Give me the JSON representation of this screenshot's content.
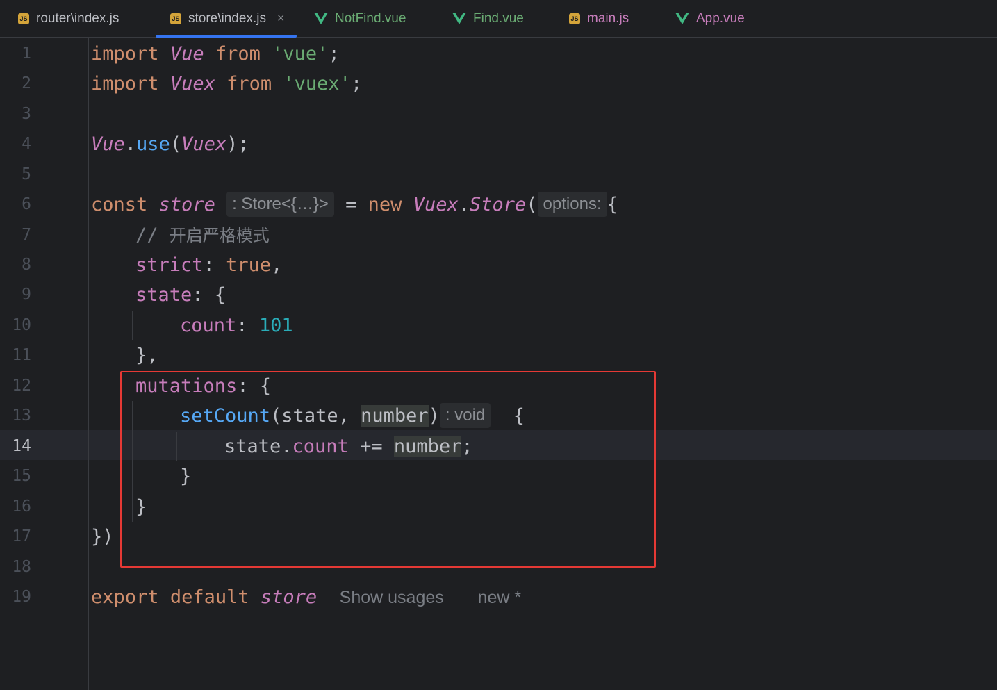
{
  "tabs": [
    {
      "label": "router\\index.js",
      "type": "js",
      "active": false
    },
    {
      "label": "store\\index.js",
      "type": "js",
      "active": true
    },
    {
      "label": "NotFind.vue",
      "type": "vue",
      "active": false
    },
    {
      "label": "Find.vue",
      "type": "vue",
      "active": false
    },
    {
      "label": "main.js",
      "type": "js",
      "active": false
    },
    {
      "label": "App.vue",
      "type": "vue",
      "active": false
    }
  ],
  "close_glyph": "×",
  "js_badge": "JS",
  "current_line": "14",
  "line_numbers": [
    "1",
    "2",
    "3",
    "4",
    "5",
    "6",
    "7",
    "8",
    "9",
    "10",
    "11",
    "12",
    "13",
    "14",
    "15",
    "16",
    "17",
    "18",
    "19"
  ],
  "code": {
    "l1": {
      "import": "import",
      "name": "Vue",
      "from": "from",
      "src": "'vue'",
      "end": ";"
    },
    "l2": {
      "import": "import",
      "name": "Vuex",
      "from": "from",
      "src": "'vuex'",
      "end": ";"
    },
    "l4": {
      "obj": "Vue",
      "dot": ".",
      "method": "use",
      "open": "(",
      "arg": "Vuex",
      "close": ");"
    },
    "l6": {
      "const": "const",
      "name": "store",
      "type_hint": ": Store<{…}>",
      "eq": "=",
      "new": "new",
      "ns": "Vuex",
      "dot": ".",
      "cls": "Store",
      "open": "(",
      "param_hint": "options:",
      "brace": "{"
    },
    "l7": {
      "slashes": "//",
      "comment": "开启严格模式"
    },
    "l8": {
      "key": "strict",
      "colon": ":",
      "value": "true",
      "comma": ","
    },
    "l9": {
      "key": "state",
      "rest": ": {"
    },
    "l10": {
      "key": "count",
      "colon": ":",
      "value": "101"
    },
    "l11": {
      "text": "},"
    },
    "l12": {
      "key": "mutations",
      "rest": ": {"
    },
    "l13": {
      "fn": "setCount",
      "open": "(state, ",
      "param": "number",
      "close": ")",
      "ret_hint": ": void",
      "brace": "{"
    },
    "l14": {
      "obj": "state",
      "dot": ".",
      "prop": "count",
      "op": "+=",
      "param": "number",
      "end": ";"
    },
    "l15": {
      "text": "}"
    },
    "l16": {
      "text": "}"
    },
    "l17": {
      "text": "})"
    },
    "l19": {
      "export": "export",
      "default": "default",
      "name": "store",
      "usages": "Show usages",
      "author": "new *"
    }
  },
  "colors": {
    "keyword": "#cf8e6d",
    "class": "#c77dbb",
    "string": "#6aab73",
    "function": "#56a8f5",
    "number": "#2aacb8",
    "annotation_box": "#e53935",
    "active_tab_underline": "#3574f0"
  }
}
